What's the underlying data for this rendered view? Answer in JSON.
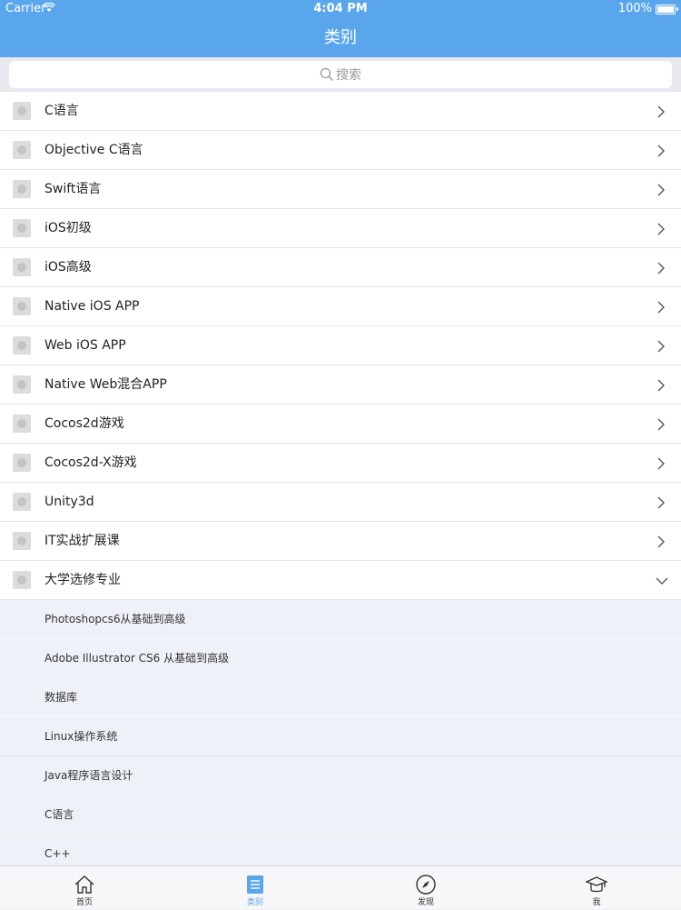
{
  "status_bar": {
    "carrier": "Carrier",
    "time": "4:04 PM",
    "battery": "100%"
  },
  "nav": {
    "title": "类别"
  },
  "search": {
    "placeholder": "搜索"
  },
  "categories": [
    {
      "label": "C语言"
    },
    {
      "label": "Objective C语言"
    },
    {
      "label": "Swift语言"
    },
    {
      "label": "iOS初级"
    },
    {
      "label": "iOS高级"
    },
    {
      "label": "Native iOS APP"
    },
    {
      "label": "Web iOS APP"
    },
    {
      "label": "Native Web混合APP"
    },
    {
      "label": "Cocos2d游戏"
    },
    {
      "label": "Cocos2d-X游戏"
    },
    {
      "label": "Unity3d"
    },
    {
      "label": "IT实战扩展课"
    },
    {
      "label": "大学选修专业"
    }
  ],
  "subcategories": [
    {
      "label": "Photoshopcs6从基础到高级"
    },
    {
      "label": "Adobe Illustrator CS6 从基础到高级"
    },
    {
      "label": "数据库"
    },
    {
      "label": "Linux操作系统"
    },
    {
      "label": "Java程序语言设计"
    },
    {
      "label": "C语言"
    },
    {
      "label": "C++"
    }
  ],
  "tabs": [
    {
      "label": "首页",
      "icon": "home-icon"
    },
    {
      "label": "类别",
      "icon": "list-icon",
      "active": true
    },
    {
      "label": "发现",
      "icon": "compass-icon"
    },
    {
      "label": "我",
      "icon": "graduation-cap-icon"
    }
  ],
  "colors": {
    "accent": "#5aa6ec"
  }
}
